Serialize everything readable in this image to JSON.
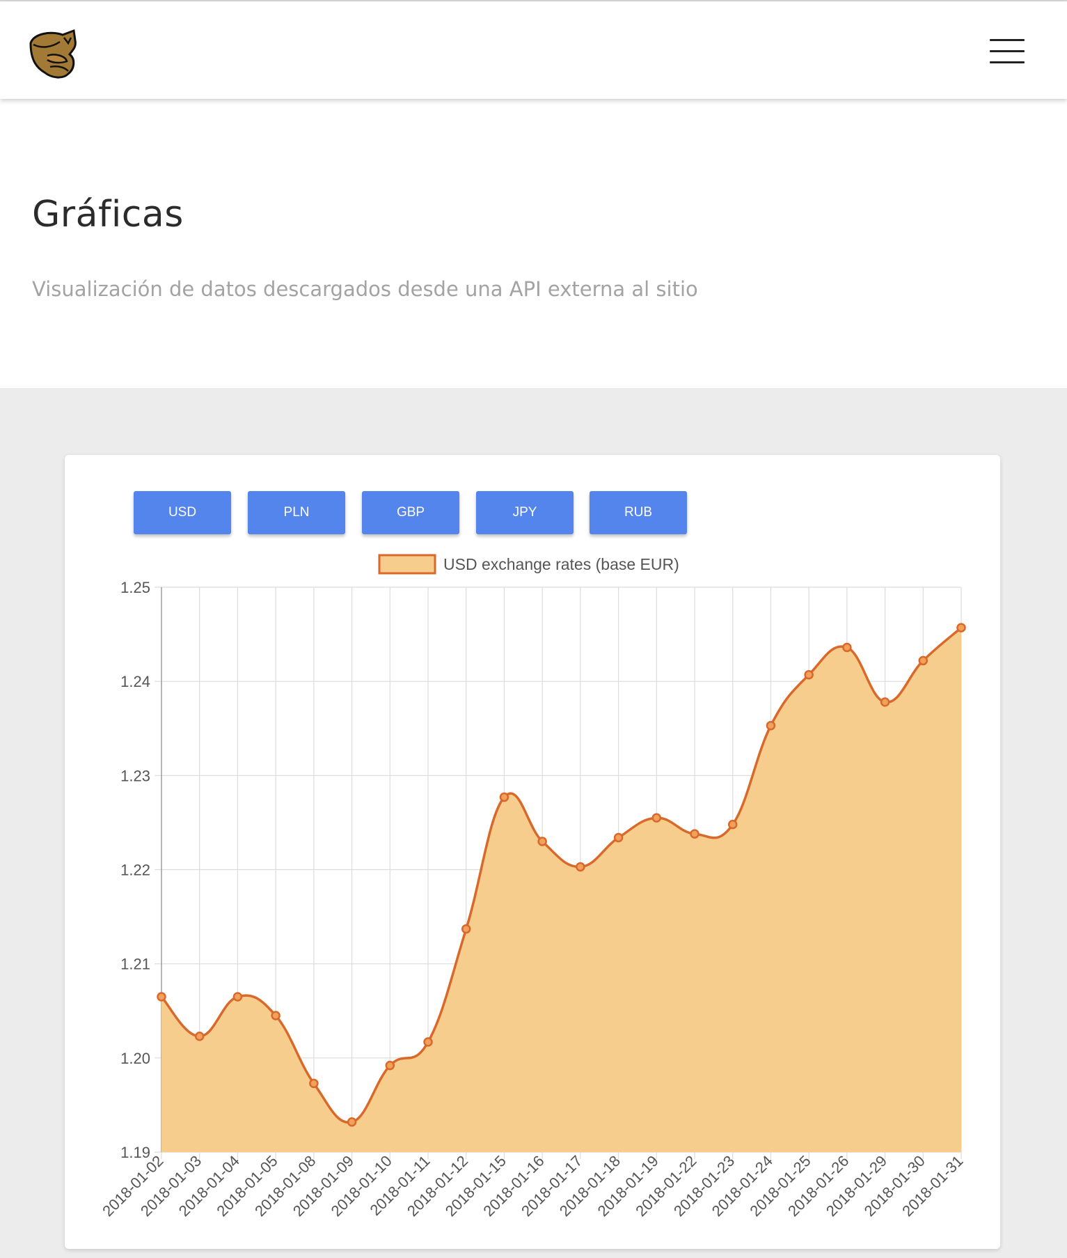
{
  "navbar": {
    "logo_icon": "bird-logo-icon",
    "menu_icon": "hamburger-menu-icon"
  },
  "hero": {
    "title": "Gráficas",
    "subtitle": "Visualización de datos descargados desde una API externa al sitio"
  },
  "currency_buttons": [
    "USD",
    "PLN",
    "GBP",
    "JPY",
    "RUB"
  ],
  "colors": {
    "button": "#5485ec",
    "line": "#d9692a",
    "fill": "#f7cd8d",
    "section_bg": "#ececec"
  },
  "chart_data": {
    "type": "area",
    "legend": "USD exchange rates (base EUR)",
    "legend_position": "top",
    "grid": true,
    "x": [
      "2018-01-02",
      "2018-01-03",
      "2018-01-04",
      "2018-01-05",
      "2018-01-08",
      "2018-01-09",
      "2018-01-10",
      "2018-01-11",
      "2018-01-12",
      "2018-01-15",
      "2018-01-16",
      "2018-01-17",
      "2018-01-18",
      "2018-01-19",
      "2018-01-22",
      "2018-01-23",
      "2018-01-24",
      "2018-01-25",
      "2018-01-26",
      "2018-01-29",
      "2018-01-30",
      "2018-01-31"
    ],
    "values": [
      1.2065,
      1.2023,
      1.2065,
      1.2045,
      1.1973,
      1.1932,
      1.1992,
      1.2017,
      1.2137,
      1.2277,
      1.223,
      1.2203,
      1.2234,
      1.2255,
      1.2238,
      1.2248,
      1.2353,
      1.2407,
      1.2436,
      1.2378,
      1.2422,
      1.2457
    ],
    "ylim": [
      1.19,
      1.25
    ],
    "yticks": [
      "1.25",
      "1.24",
      "1.23",
      "1.22",
      "1.21",
      "1.20",
      "1.19"
    ]
  }
}
